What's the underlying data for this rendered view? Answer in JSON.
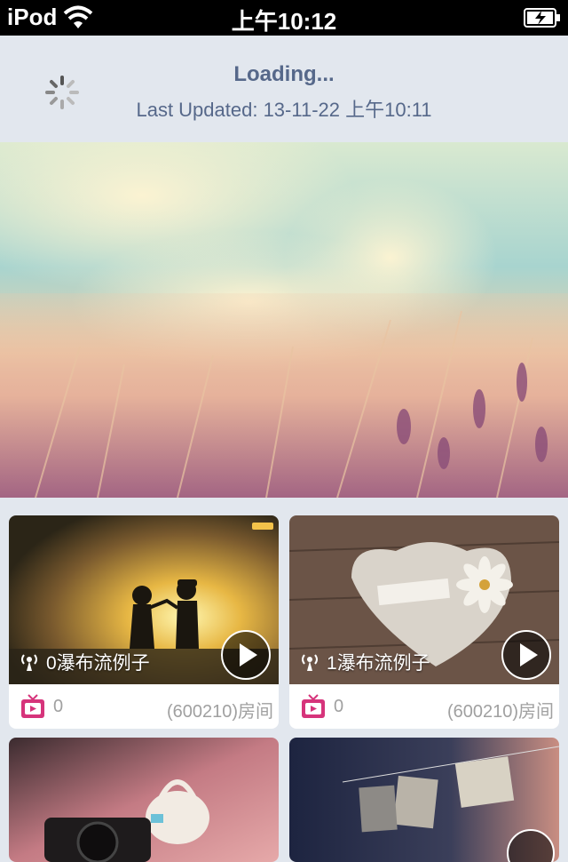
{
  "status_bar": {
    "carrier": "iPod",
    "time": "上午10:12"
  },
  "refresh_header": {
    "title": "Loading...",
    "last_updated": "Last Updated: 13-11-22 上午10:11"
  },
  "cards": [
    {
      "title": "0瀑布流例子",
      "count": "0",
      "room": "(600210)房间"
    },
    {
      "title": "1瀑布流例子",
      "count": "0",
      "room": "(600210)房间"
    }
  ],
  "colors": {
    "header_text": "#56688a",
    "background": "#e2e7ee",
    "tv_icon": "#d6347b",
    "meta_text": "#a0a0a0"
  }
}
